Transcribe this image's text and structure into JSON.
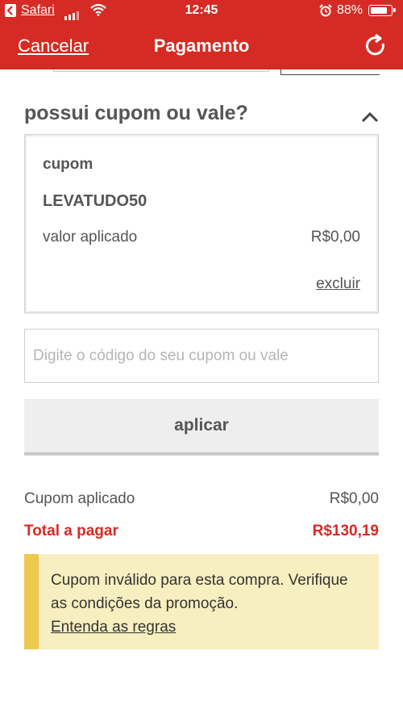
{
  "status_bar": {
    "app": "Safari",
    "time": "12:45",
    "battery": "88%",
    "battery_level": 0.88
  },
  "nav": {
    "cancel": "Cancelar",
    "title": "Pagamento"
  },
  "coupon_section": {
    "title": "possui cupom ou vale?",
    "card": {
      "label": "cupom",
      "code": "LEVATUDO50",
      "applied_label": "valor aplicado",
      "applied_value": "R$0,00",
      "remove": "excluir"
    },
    "input": {
      "value": "",
      "placeholder": "Digite o código do seu cupom ou vale"
    },
    "apply_button": "aplicar"
  },
  "summary": {
    "coupon_label": "Cupom aplicado",
    "coupon_value": "R$0,00",
    "total_label": "Total a pagar",
    "total_value": "R$130,19"
  },
  "alert": {
    "message": "Cupom inválido para esta compra. Verifique as condições da promoção.",
    "link": "Entenda as regras"
  },
  "colors": {
    "brand_red": "#d52b24",
    "alert_bg": "#f8efc0",
    "alert_accent": "#eec94f"
  },
  "icons": {
    "back": "back-arrow-icon",
    "signal": "signal-icon",
    "wifi": "wifi-icon",
    "alarm": "alarm-icon",
    "battery": "battery-icon",
    "refresh": "refresh-icon",
    "collapse": "chevron-up-icon"
  }
}
